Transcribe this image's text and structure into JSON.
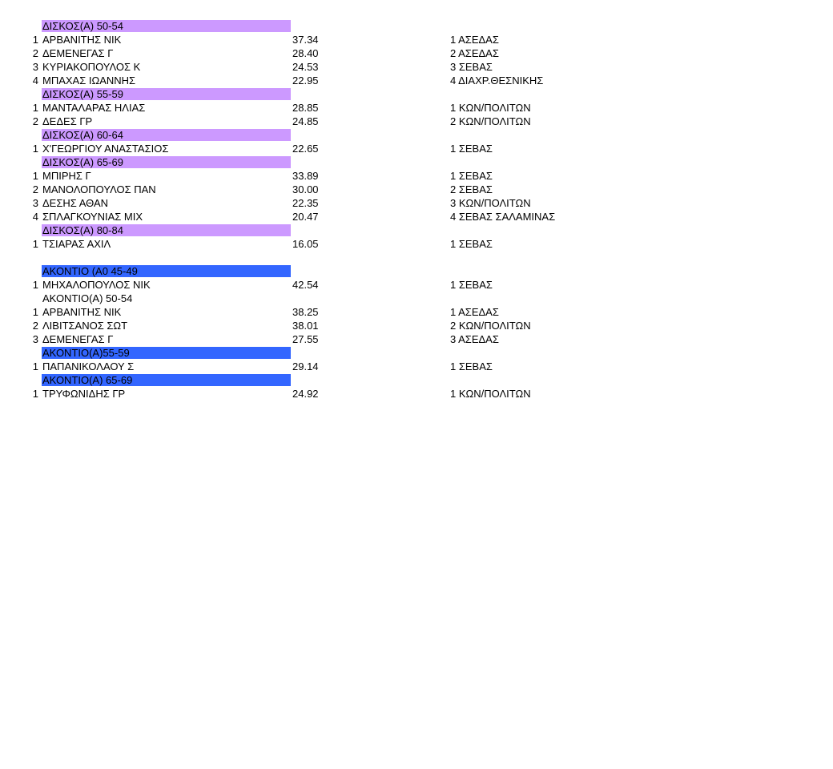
{
  "colors": {
    "discus_header": "#cc99ff",
    "javelin_header": "#3366ff"
  },
  "sections": [
    {
      "title": "ΔΙΣΚΟΣ(Α) 50-54",
      "fill": "purple",
      "rows": [
        {
          "rank": "1",
          "name": "ΑΡΒΑΝΙΤΗΣ ΝΙΚ",
          "mark": "37.34",
          "club": "1 ΑΣΕΔΑΣ"
        },
        {
          "rank": "2",
          "name": "ΔΕΜΕΝΕΓΑΣ Γ",
          "mark": "28.40",
          "club": "2 ΑΣΕΔΑΣ"
        },
        {
          "rank": "3",
          "name": "ΚΥΡΙΑΚΟΠΟΥΛΟΣ Κ",
          "mark": "24.53",
          "club": "3 ΣΕΒΑΣ"
        },
        {
          "rank": "4",
          "name": "ΜΠΑΧΑΣ ΙΩΑΝΝΗΣ",
          "mark": "22.95",
          "club": "4 ΔΙΑΧΡ.ΘΕΣΝΙΚΗΣ"
        }
      ]
    },
    {
      "title": "ΔΙΣΚΟΣ(Α) 55-59",
      "fill": "purple",
      "rows": [
        {
          "rank": "1",
          "name": "ΜΑΝΤΑΛΑΡΑΣ ΗΛΙΑΣ",
          "mark": "28.85",
          "club": "1 ΚΩΝ/ΠΟΛΙΤΩΝ"
        },
        {
          "rank": "2",
          "name": "ΔΕΔΕΣ ΓΡ",
          "mark": "24.85",
          "club": "2 ΚΩΝ/ΠΟΛΙΤΩΝ"
        }
      ]
    },
    {
      "title": "ΔΙΣΚΟΣ(Α) 60-64",
      "fill": "purple",
      "rows": [
        {
          "rank": "1",
          "name": "Χ'ΓΕΩΡΓΙΟΥ ΑΝΑΣΤΑΣΙΟΣ",
          "mark": "22.65",
          "club": "1 ΣΕΒΑΣ"
        }
      ]
    },
    {
      "title": "ΔΙΣΚΟΣ(Α) 65-69",
      "fill": "purple",
      "rows": [
        {
          "rank": "1",
          "name": "ΜΠΙΡΗΣ Γ",
          "mark": "33.89",
          "club": "1 ΣΕΒΑΣ"
        },
        {
          "rank": "2",
          "name": "ΜΑΝΟΛΟΠΟΥΛΟΣ ΠΑΝ",
          "mark": "30.00",
          "club": "2 ΣΕΒΑΣ"
        },
        {
          "rank": "3",
          "name": "ΔΕΣΗΣ ΑΘΑΝ",
          "mark": "22.35",
          "club": "3 ΚΩΝ/ΠΟΛΙΤΩΝ"
        },
        {
          "rank": "4",
          "name": "ΣΠΛΑΓΚΟΥΝΙΑΣ ΜΙΧ",
          "mark": "20.47",
          "club": "4 ΣΕΒΑΣ ΣΑΛΑΜΙΝΑΣ"
        }
      ]
    },
    {
      "title": "ΔΙΣΚΟΣ(Α) 80-84",
      "fill": "purple",
      "rows": [
        {
          "rank": "1",
          "name": "ΤΣΙΑΡΑΣ ΑΧΙΛ",
          "mark": "16.05",
          "club": "1 ΣΕΒΑΣ"
        }
      ],
      "blank_after": true
    },
    {
      "title": "ΑΚΟΝΤΙΟ (Α0 45-49",
      "fill": "blue",
      "rows": [
        {
          "rank": "1",
          "name": "ΜΗΧΑΛΟΠΟΥΛΟΣ ΝΙΚ",
          "mark": "42.54",
          "club": "1 ΣΕΒΑΣ"
        }
      ]
    },
    {
      "title": "ΑΚΟΝΤΙΟ(Α) 50-54",
      "fill": "none",
      "rows": [
        {
          "rank": "1",
          "name": "ΑΡΒΑΝΙΤΗΣ ΝΙΚ",
          "mark": "38.25",
          "club": "1 ΑΣΕΔΑΣ"
        },
        {
          "rank": "2",
          "name": "ΛΙΒΙΤΣΑΝΟΣ ΣΩΤ",
          "mark": "38.01",
          "club": "2 ΚΩΝ/ΠΟΛΙΤΩΝ"
        },
        {
          "rank": "3",
          "name": "ΔΕΜΕΝΕΓΑΣ Γ",
          "mark": "27.55",
          "club": "3 ΑΣΕΔΑΣ"
        }
      ]
    },
    {
      "title": "ΑΚΟΝΤΙΟ(Α)55-59",
      "fill": "blue",
      "rows": [
        {
          "rank": "1",
          "name": "ΠΑΠΑΝΙΚΟΛΑΟΥ Σ",
          "mark": "29.14",
          "club": "1 ΣΕΒΑΣ"
        }
      ]
    },
    {
      "title": "ΑΚΟΝΤΙΟ(Α) 65-69",
      "fill": "blue",
      "rows": [
        {
          "rank": "1",
          "name": "ΤΡΥΦΩΝΙΔΗΣ ΓΡ",
          "mark": "24.92",
          "club": "1 ΚΩΝ/ΠΟΛΙΤΩΝ"
        }
      ]
    }
  ]
}
